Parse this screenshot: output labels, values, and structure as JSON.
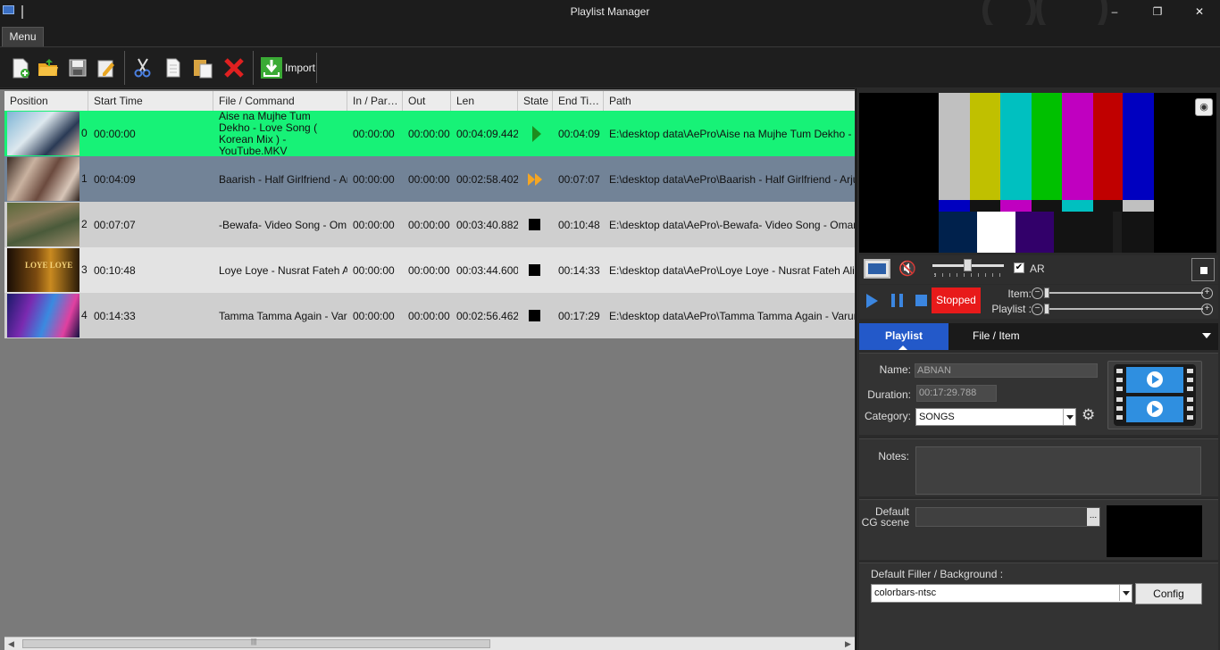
{
  "window": {
    "title": "Playlist Manager",
    "minimize": "‒",
    "restore": "❐",
    "close": "✕"
  },
  "menu": {
    "label": "Menu"
  },
  "toolbar": {
    "import_label": "Import"
  },
  "grid": {
    "columns": [
      "Position",
      "Start Time",
      "File / Command",
      "In / Par…",
      "Out",
      "Len",
      "State",
      "End Ti…",
      "Path"
    ],
    "rows": [
      {
        "index": "0",
        "start": "00:00:00",
        "file": "Aise na Mujhe Tum Dekho - Love Song ( Korean Mix ) - YouTube.MKV",
        "in": "00:00:00",
        "out": "00:00:00",
        "len": "00:04:09.442",
        "state": "playing",
        "end": "00:04:09",
        "path": "E:\\desktop data\\AePro\\Aise na Mujhe Tum Dekho - Love"
      },
      {
        "index": "1",
        "start": "00:04:09",
        "file": "Baarish - Half Girlfriend - Arj…",
        "in": "00:00:00",
        "out": "00:00:00",
        "len": "00:02:58.402",
        "state": "next",
        "end": "00:07:07",
        "path": "E:\\desktop data\\AePro\\Baarish - Half Girlfriend - Arjun K &"
      },
      {
        "index": "2",
        "start": "00:07:07",
        "file": "-Bewafa- Video Song - Om…",
        "in": "00:00:00",
        "out": "00:00:00",
        "len": "00:03:40.882",
        "state": "stopped",
        "end": "00:10:48",
        "path": "E:\\desktop data\\AePro\\-Bewafa- Video Song - Omar Malik"
      },
      {
        "index": "3",
        "start": "00:10:48",
        "file": "Loye Loye - Nusrat Fateh A…",
        "in": "00:00:00",
        "out": "00:00:00",
        "len": "00:03:44.600",
        "state": "stopped",
        "end": "00:14:33",
        "path": "E:\\desktop data\\AePro\\Loye Loye - Nusrat Fateh Ali Khan"
      },
      {
        "index": "4",
        "start": "00:14:33",
        "file": "Tamma Tamma Again - Var…",
        "in": "00:00:00",
        "out": "00:00:00",
        "len": "00:02:56.462",
        "state": "stopped",
        "end": "00:17:29",
        "path": "E:\\desktop data\\AePro\\Tamma Tamma Again - Varun , A"
      }
    ],
    "thumb_texts": {
      "row3": "LOYE LOYE"
    },
    "scroll_grip": "|||"
  },
  "player": {
    "ar_label": "AR",
    "ar_checked": "✔",
    "status": "Stopped",
    "item_label": "Item:",
    "playlist_label": "Playlist :",
    "volume_level": 0.5,
    "colors": {
      "status_red": "#e81a1a",
      "accent_blue": "#3b86e0"
    }
  },
  "tabs": {
    "active": "Playlist",
    "second": "File / Item"
  },
  "form": {
    "name_label": "Name:",
    "name_value": "ABNAN",
    "duration_label": "Duration:",
    "duration_value": "00:17:29.788",
    "category_label": "Category:",
    "category_value": "SONGS",
    "notes_label": "Notes:",
    "cg_label_1": "Default",
    "cg_label_2": "CG scene",
    "cg_browse": "...",
    "filler_label": "Default Filler / Background :",
    "filler_value": "colorbars-ntsc",
    "config_label": "Config"
  },
  "colors": {
    "playing_row": "#17f277",
    "next_row": "#728397",
    "row_light": "#cfcfcf",
    "row_lighter": "#e3e3e3",
    "tab_active": "#2359c9"
  }
}
